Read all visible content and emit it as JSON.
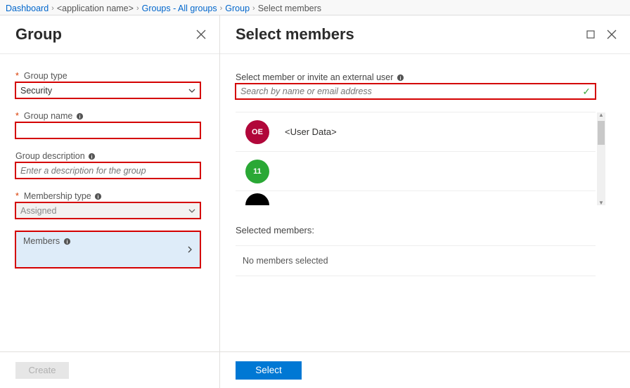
{
  "breadcrumb": {
    "dashboard": "Dashboard",
    "app_label": "<application name>",
    "groups": "Groups - All groups",
    "group": "Group",
    "current": "Select members"
  },
  "left": {
    "title": "Group",
    "group_type_label": "Group type",
    "group_type_value": "Security",
    "group_name_label": "Group name",
    "group_name_value": "",
    "group_desc_label": "Group description",
    "group_desc_placeholder": "Enter a description for the group",
    "membership_type_label": "Membership type",
    "membership_type_value": "Assigned",
    "members_label": "Members",
    "create_btn": "Create"
  },
  "right": {
    "title": "Select members",
    "search_label": "Select member or invite an external user",
    "search_placeholder": "Search by name or email address",
    "users": [
      {
        "initials": "OE",
        "color": "#b1073a",
        "name": "<User Data>"
      },
      {
        "initials": "11",
        "color": "#2aa835",
        "name": ""
      }
    ],
    "partial_user_color": "#000000",
    "selected_header": "Selected members:",
    "selected_empty": "No members selected",
    "select_btn": "Select"
  }
}
